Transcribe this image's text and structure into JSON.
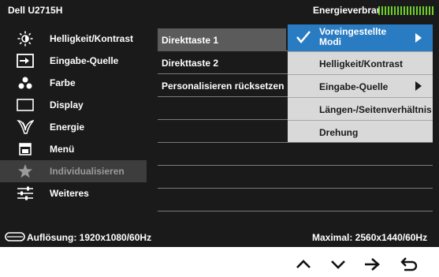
{
  "header": {
    "model": "Dell U2715H",
    "energy_label": "Energieverbrauch",
    "energy_meter_color": "#6fcf2a"
  },
  "sidebar": {
    "items": [
      {
        "label": "Helligkeit/Kontrast",
        "icon": "brightness-icon",
        "active": false
      },
      {
        "label": "Eingabe-Quelle",
        "icon": "input-source-icon",
        "active": false
      },
      {
        "label": "Farbe",
        "icon": "color-dots-icon",
        "active": false
      },
      {
        "label": "Display",
        "icon": "display-icon",
        "active": false
      },
      {
        "label": "Energie",
        "icon": "energy-leaf-icon",
        "active": false
      },
      {
        "label": "Menü",
        "icon": "menu-icon",
        "active": false
      },
      {
        "label": "Individualisieren",
        "icon": "star-icon",
        "active": true
      },
      {
        "label": "Weiteres",
        "icon": "sliders-icon",
        "active": false
      }
    ]
  },
  "middle": {
    "items": [
      {
        "label": "Direkttaste 1",
        "selected": true
      },
      {
        "label": "Direkttaste 2",
        "selected": false
      },
      {
        "label": "Personalisieren rücksetzen",
        "selected": false
      }
    ]
  },
  "submenu": {
    "items": [
      {
        "label": "Voreingestellte Modi",
        "checked": true,
        "has_arrow": true
      },
      {
        "label": "Helligkeit/Kontrast",
        "checked": false,
        "has_arrow": false
      },
      {
        "label": "Eingabe-Quelle",
        "checked": false,
        "has_arrow": true
      },
      {
        "label": "Längen-/Seitenverhältnis",
        "checked": false,
        "has_arrow": false
      },
      {
        "label": "Drehung",
        "checked": false,
        "has_arrow": false
      }
    ],
    "highlight_color": "#2a7cc2"
  },
  "footer": {
    "resolution_label": "Auflösung: 1920x1080/60Hz",
    "max_label": "Maximal: 2560x1440/60Hz"
  },
  "nav_buttons": [
    "up-arrow-icon",
    "down-arrow-icon",
    "right-arrow-icon",
    "back-icon"
  ]
}
